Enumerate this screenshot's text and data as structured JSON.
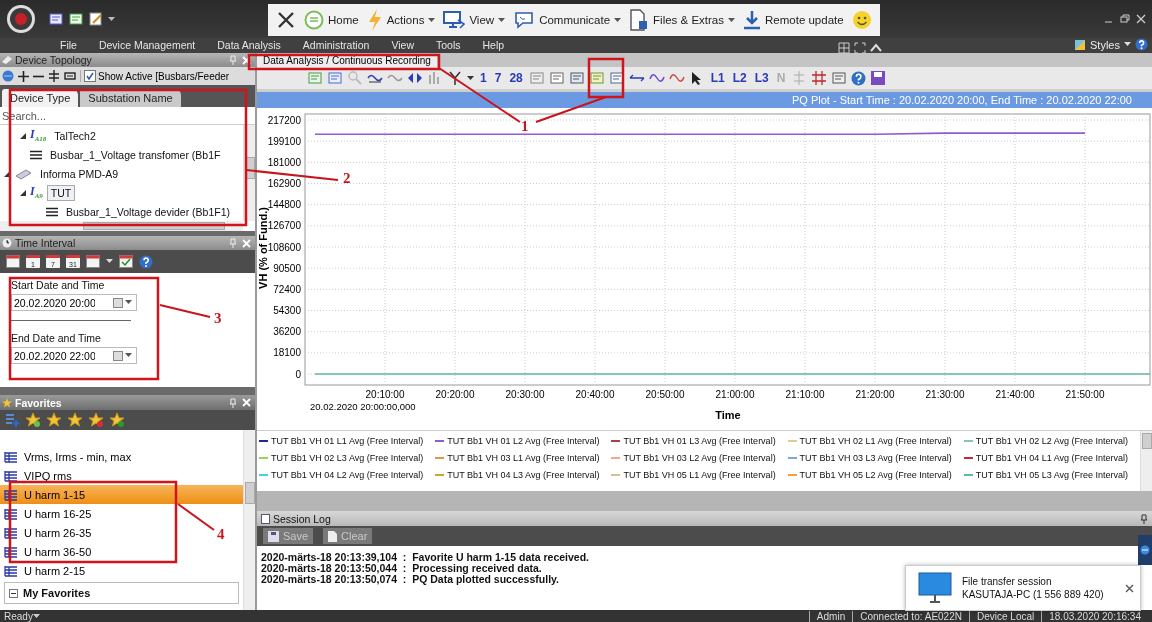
{
  "remote_toolbar": {
    "items": [
      {
        "kind": "home",
        "label": "Home",
        "dropdown": false
      },
      {
        "kind": "bolt",
        "label": "Actions",
        "dropdown": true
      },
      {
        "kind": "monitor",
        "label": "View",
        "dropdown": true
      },
      {
        "kind": "chat",
        "label": "Communicate",
        "dropdown": true
      },
      {
        "kind": "files",
        "label": "Files & Extras",
        "dropdown": true
      },
      {
        "kind": "download",
        "label": "Remote update",
        "dropdown": false
      }
    ]
  },
  "menu": [
    "File",
    "Device Management",
    "Data Analysis",
    "Administration",
    "View",
    "Tools",
    "Help"
  ],
  "styles_menu": {
    "label": "Styles"
  },
  "device_topology": {
    "title": "Device Topology",
    "show_active": {
      "label": "Show Active [Busbars/Feeder",
      "checked": true
    },
    "tabs": [
      {
        "label": "Device Type",
        "selected": true
      },
      {
        "label": "Substation Name",
        "selected": false
      }
    ],
    "search": {
      "placeholder": "Search..."
    },
    "tree": [
      {
        "kind": "meter",
        "icon_text": "I$_{A}$$_{18}$",
        "label": "TalTech2",
        "expanded": true,
        "selected": false,
        "children": [
          {
            "kind": "busbar",
            "label": "Busbar_1_Voltage transfomer (Bb1F",
            "selected": false
          }
        ]
      },
      {
        "kind": "device",
        "label": "Informa PMD-A9",
        "expanded": true,
        "selected": false,
        "children": [
          {
            "kind": "meter",
            "icon_text": "I$_{A}$$_{9}$",
            "label": "TUT",
            "expanded": true,
            "selected": true,
            "children": [
              {
                "kind": "busbar",
                "label": "Busbar_1_Voltage devider (Bb1F1)",
                "selected": false
              }
            ]
          }
        ]
      }
    ]
  },
  "time_interval": {
    "title": "Time Interval",
    "range_buttons": [
      "1",
      "7",
      "31"
    ],
    "start": {
      "label": "Start Date and Time",
      "value": "20.02.2020 20:00"
    },
    "end": {
      "label": "End Date and Time",
      "value": "20.02.2020 22:00"
    }
  },
  "favorites": {
    "title": "Favorites",
    "items": [
      {
        "label": "Vrms, Irms - min, max",
        "selected": false
      },
      {
        "label": "VIPQ rms",
        "selected": false
      },
      {
        "label": "U harm 1-15",
        "selected": true
      },
      {
        "label": "U harm 16-25",
        "selected": false
      },
      {
        "label": "U harm 26-35",
        "selected": false
      },
      {
        "label": "U harm 36-50",
        "selected": false
      },
      {
        "label": "U harm 2-15",
        "selected": false
      }
    ],
    "group": {
      "label": "My Favorites",
      "expanded": true
    }
  },
  "document": {
    "tab": "Data Analysis / Continuous Recording",
    "day_buttons": [
      "1",
      "7",
      "28"
    ],
    "phase_buttons": [
      {
        "label": "L1",
        "disabled": false
      },
      {
        "label": "L2",
        "disabled": false
      },
      {
        "label": "L3",
        "disabled": false
      },
      {
        "label": "N",
        "disabled": true
      }
    ]
  },
  "plot": {
    "title": "PQ Plot - Start Time : 20.02.2020 20:00, End Time : 20.02.2020 22:00",
    "origin_label": "20.02.2020 20:00:00,000",
    "chart_data": {
      "type": "line",
      "xlabel": "Time",
      "ylabel": "VH (% of Fund.)",
      "categories": [
        null,
        "20:10:00",
        "20:20:00",
        "20:30:00",
        "20:40:00",
        "20:50:00",
        "21:00:00",
        "21:10:00",
        "21:20:00",
        "21:30:00",
        "21:40:00",
        "21:50:00",
        null
      ],
      "yticks": [
        0,
        18100,
        36200,
        54300,
        72400,
        90500,
        108600,
        126700,
        144800,
        162900,
        181000,
        199100,
        217200
      ],
      "ylim": [
        0,
        217200
      ],
      "grid": true,
      "series": [
        {
          "name": "TUT Bb1 VH 01 L1 Avg (Free Interval)",
          "color": "#1f2a8f",
          "values": [
            null,
            null,
            null,
            null,
            null,
            null,
            null,
            null,
            null,
            null,
            null,
            null,
            null
          ]
        },
        {
          "name": "TUT Bb1 VH 01 L2 Avg (Free Interval)",
          "color": "#8e5bd1",
          "values": [
            205000,
            205000,
            205000,
            205000,
            205000,
            205000,
            205000,
            205000,
            205000,
            206000,
            206000,
            206000,
            null
          ]
        },
        {
          "name": "TUT Bb1 VH 01 L3 Avg (Free Interval)",
          "color": "#a8404a",
          "values": [
            null,
            null,
            null,
            null,
            null,
            null,
            null,
            null,
            null,
            null,
            null,
            null,
            null
          ]
        },
        {
          "name": "TUT Bb1 VH 02 L1 Avg (Free Interval)",
          "color": "#e3c88f",
          "values": [
            null,
            null,
            null,
            null,
            null,
            null,
            null,
            null,
            null,
            null,
            null,
            null,
            null
          ]
        },
        {
          "name": "TUT Bb1 VH 02 L2 Avg (Free Interval)",
          "color": "#7fc6b8",
          "values": [
            null,
            null,
            null,
            null,
            null,
            null,
            null,
            null,
            null,
            null,
            null,
            null,
            null
          ]
        },
        {
          "name": "TUT Bb1 VH 02 L3 Avg (Free Interval)",
          "color": "#9ad15a",
          "values": [
            null,
            null,
            null,
            null,
            null,
            null,
            null,
            null,
            null,
            null,
            null,
            null,
            null
          ]
        },
        {
          "name": "TUT Bb1 VH 03 L1 Avg (Free Interval)",
          "color": "#e8924a",
          "values": [
            null,
            null,
            null,
            null,
            null,
            null,
            null,
            null,
            null,
            null,
            null,
            null,
            null
          ]
        },
        {
          "name": "TUT Bb1 VH 03 L2 Avg (Free Interval)",
          "color": "#f0a890",
          "values": [
            null,
            null,
            null,
            null,
            null,
            null,
            null,
            null,
            null,
            null,
            null,
            null,
            null
          ]
        },
        {
          "name": "TUT Bb1 VH 03 L3 Avg (Free Interval)",
          "color": "#7fa8d8",
          "values": [
            null,
            null,
            null,
            null,
            null,
            null,
            null,
            null,
            null,
            null,
            null,
            null,
            null
          ]
        },
        {
          "name": "TUT Bb1 VH 04 L1 Avg (Free Interval)",
          "color": "#c8283c",
          "values": [
            null,
            null,
            null,
            null,
            null,
            null,
            null,
            null,
            null,
            null,
            null,
            null,
            null
          ]
        },
        {
          "name": "TUT Bb1 VH 04 L2 Avg (Free Interval)",
          "color": "#48d0e0",
          "values": [
            null,
            null,
            null,
            null,
            null,
            null,
            null,
            null,
            null,
            null,
            null,
            null,
            null
          ]
        },
        {
          "name": "TUT Bb1 VH 04 L3 Avg (Free Interval)",
          "color": "#c8a830",
          "values": [
            null,
            null,
            null,
            null,
            null,
            null,
            null,
            null,
            null,
            null,
            null,
            null,
            null
          ]
        },
        {
          "name": "TUT Bb1 VH 05 L1 Avg (Free Interval)",
          "color": "#cfc49c",
          "values": [
            null,
            null,
            null,
            null,
            null,
            null,
            null,
            null,
            null,
            null,
            null,
            null,
            null
          ]
        },
        {
          "name": "TUT Bb1 VH 05 L2 Avg (Free Interval)",
          "color": "#f0a040",
          "values": [
            null,
            null,
            null,
            null,
            null,
            null,
            null,
            null,
            null,
            null,
            null,
            null,
            null
          ]
        },
        {
          "name": "TUT Bb1 VH 05 L3 Avg (Free Interval)",
          "color": "#5fb8a0",
          "values": [
            0,
            0,
            0,
            0,
            0,
            0,
            0,
            0,
            0,
            0,
            0,
            0,
            0
          ]
        }
      ]
    }
  },
  "session_log": {
    "title": "Session Log",
    "buttons": [
      {
        "kind": "save",
        "label": "Save",
        "disabled": true
      },
      {
        "kind": "clear",
        "label": "Clear",
        "disabled": true
      }
    ],
    "entries": [
      "2020-märts-18 20:13:39,104  :  Favorite U harm 1-15 data received.",
      "2020-märts-18 20:13:50,044  :  Processing received data.",
      "2020-märts-18 20:13:50,074  :  PQ Data plotted successfully."
    ]
  },
  "notification": {
    "title": "File transfer session",
    "detail": "KASUTAJA-PC (1 556 889 420)"
  },
  "status_bar": {
    "left": "Ready",
    "items": [
      "Admin",
      "Connected to: AE022N",
      "Device Local",
      "18.03.2020 20:16:34"
    ]
  },
  "annotations": [
    {
      "label": "1"
    },
    {
      "label": "2"
    },
    {
      "label": "3"
    },
    {
      "label": "4"
    }
  ]
}
